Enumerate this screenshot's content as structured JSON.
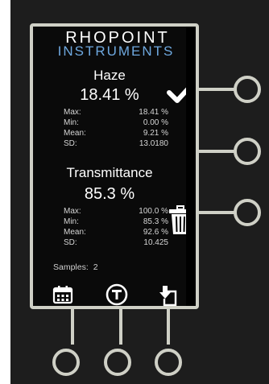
{
  "brand": {
    "line1": "RHOPOINT",
    "line2": "INSTRUMENTS"
  },
  "haze": {
    "title": "Haze",
    "value": "18.41 %",
    "stats": [
      {
        "label": "Max:",
        "value": "18.41 %"
      },
      {
        "label": "Min:",
        "value": "0.00 %"
      },
      {
        "label": "Mean:",
        "value": "9.21 %"
      },
      {
        "label": "SD:",
        "value": "13.0180"
      }
    ]
  },
  "transmittance": {
    "title": "Transmittance",
    "value": "85.3 %",
    "stats": [
      {
        "label": "Max:",
        "value": "100.0 %"
      },
      {
        "label": "Min:",
        "value": "85.3 %"
      },
      {
        "label": "Mean:",
        "value": "92.6 %"
      },
      {
        "label": "SD:",
        "value": "10.425"
      }
    ]
  },
  "samples": {
    "label": "Samples:",
    "value": "2"
  },
  "icons": [
    "check-icon",
    "trash-icon",
    "calendar-icon",
    "t-circle-icon",
    "export-icon"
  ],
  "colors": {
    "bezel": "#cfd0c6",
    "brand_blue": "#6ea8df",
    "background": "#1d1d1d"
  }
}
